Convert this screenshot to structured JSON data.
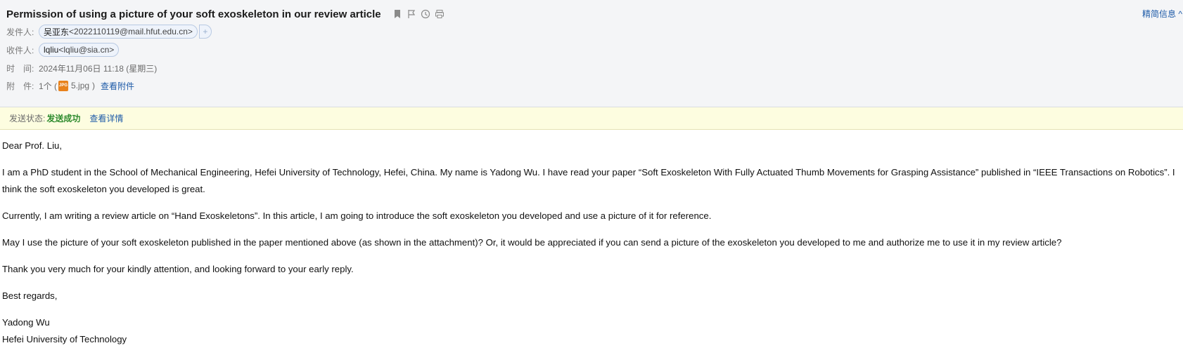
{
  "subject": "Permission of using a picture of your soft exoskeleton in our review article",
  "header_icons": [
    "bookmark-icon",
    "flag-icon",
    "clock-icon",
    "print-icon"
  ],
  "toggle_label": "精简信息 ^",
  "sender": {
    "label": "发件人:",
    "name": "吴亚东",
    "address": "<2022110119@mail.hfut.edu.cn>",
    "add_label": "+"
  },
  "recipient": {
    "label": "收件人:",
    "name": "lqliu",
    "address": "<lqliu@sia.cn>"
  },
  "time": {
    "label": "时　间:",
    "value": "2024年11月06日 11:18 (星期三)"
  },
  "attachment": {
    "label": "附　件:",
    "count": "1个 (",
    "icon_text": "JPG",
    "filename": "5.jpg",
    "close_paren": ")",
    "view_link": "查看附件"
  },
  "status": {
    "label": "发送状态:",
    "value": "发送成功",
    "link": "查看详情"
  },
  "body": {
    "greeting": "Dear Prof. Liu,",
    "p1": "I am a PhD student in the School of Mechanical Engineering, Hefei University of Technology, Hefei, China. My name is Yadong Wu. I have read your paper “Soft Exoskeleton With Fully Actuated Thumb Movements for Grasping Assistance” published in “IEEE Transactions on Robotics”. I think the soft exoskeleton you developed is great.",
    "p2": "Currently, I am writing a review article on “Hand Exoskeletons”. In this article, I am going to introduce the soft exoskeleton you developed and use a picture of it for reference.",
    "p3": "May I use the picture of your soft exoskeleton published in the paper mentioned above (as shown in the attachment)? Or, it would be appreciated if you can send a picture of the exoskeleton you developed to me and authorize me to use it in my review article?",
    "p4": "Thank you very much for your kindly attention, and looking forward to your early reply.",
    "closing": "Best regards,",
    "sig_name": "Yadong Wu",
    "sig_org": "Hefei University of Technology"
  }
}
